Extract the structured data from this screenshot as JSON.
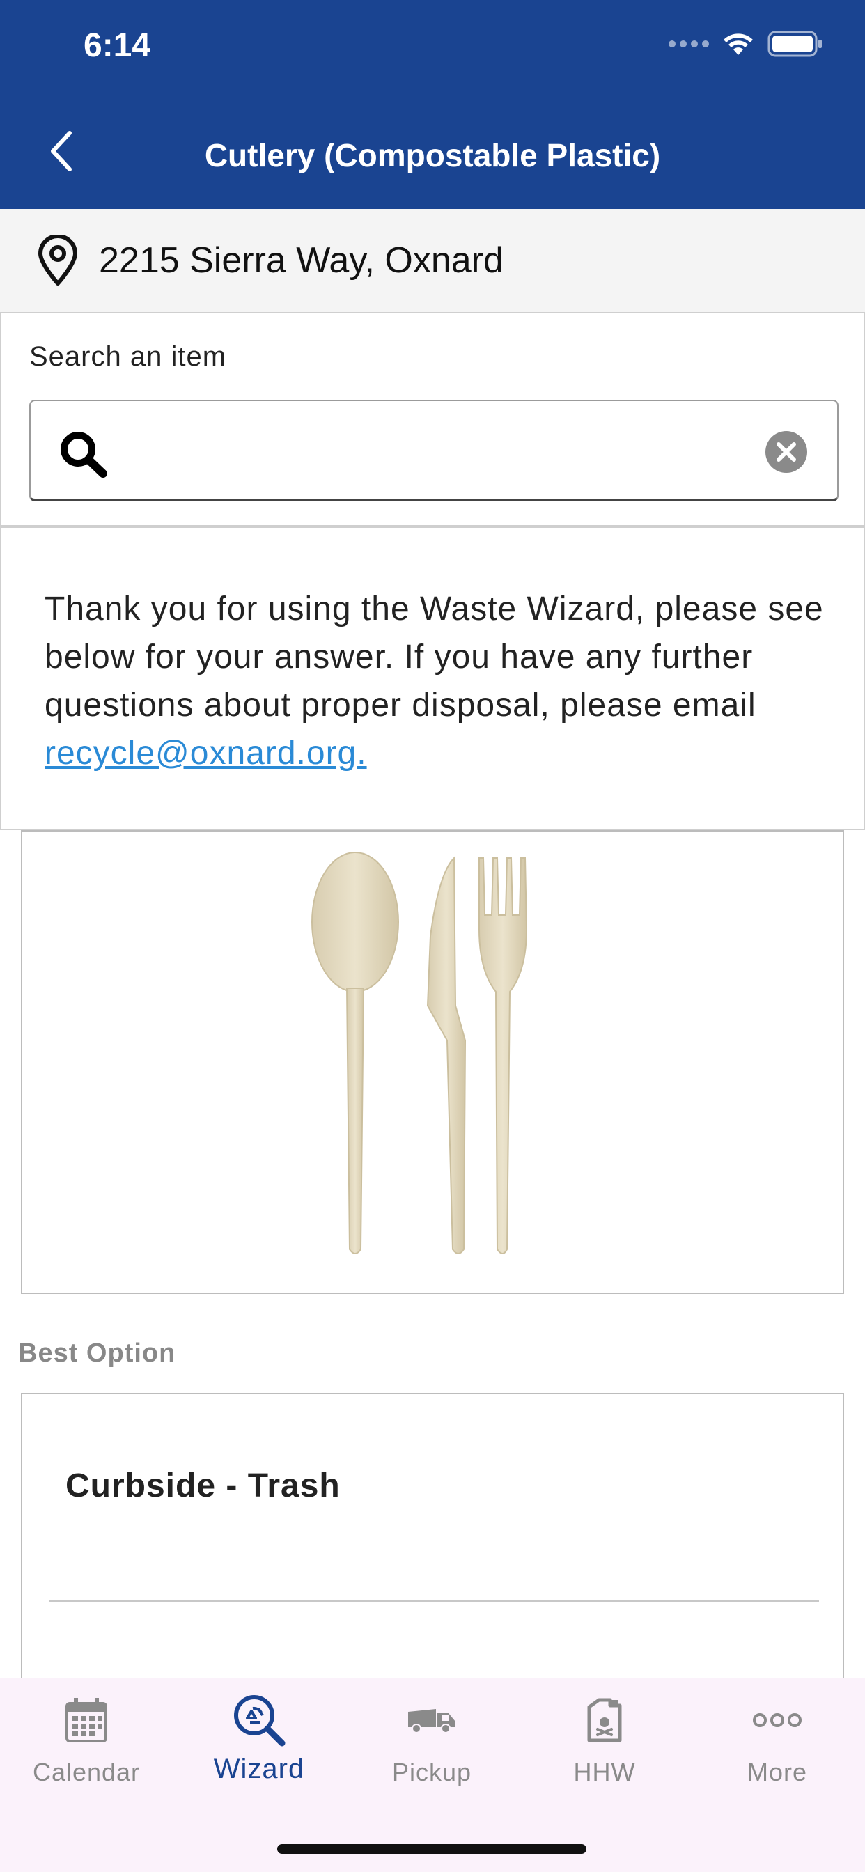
{
  "status_bar": {
    "time": "6:14"
  },
  "header": {
    "title": "Cutlery (Compostable Plastic)"
  },
  "address": {
    "text": "2215 Sierra Way, Oxnard"
  },
  "search": {
    "label": "Search an item",
    "value": ""
  },
  "message": {
    "text": "Thank you for using the Waste Wizard, please see below for your answer. If you have any further questions about proper disposal, please email ",
    "email": "recycle@oxnard.org."
  },
  "item_image": {
    "icon": "cutlery-image"
  },
  "best_option": {
    "label": "Best Option",
    "title": "Curbside - Trash"
  },
  "tab_bar": {
    "active": "Wizard",
    "tabs": [
      {
        "label": "Calendar",
        "icon": "calendar-icon"
      },
      {
        "label": "Wizard",
        "icon": "recycle-search-icon"
      },
      {
        "label": "Pickup",
        "icon": "truck-icon"
      },
      {
        "label": "HHW",
        "icon": "hazard-container-icon"
      },
      {
        "label": "More",
        "icon": "more-dots-icon"
      }
    ]
  },
  "colors": {
    "header_bg": "#1a4491",
    "link": "#2a8ad6",
    "active_tab": "#1a4491",
    "inactive_tab": "#8a8a8a"
  }
}
